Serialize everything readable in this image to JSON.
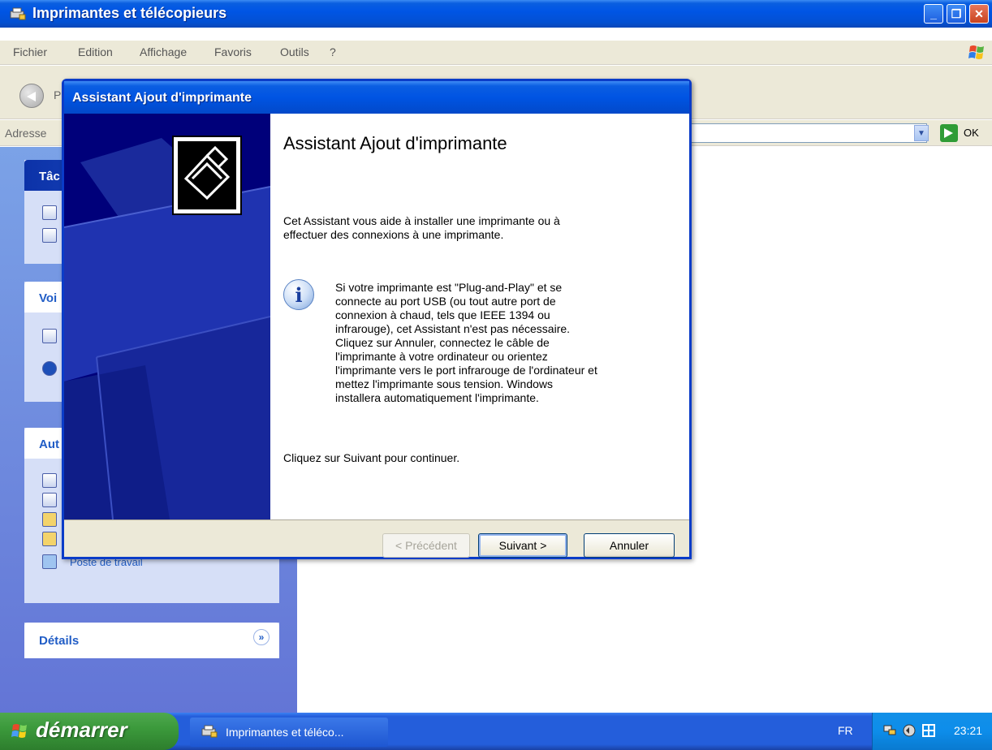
{
  "explorer": {
    "title": "Imprimantes et télécopieurs",
    "menu": [
      "Fichier",
      "Edition",
      "Affichage",
      "Favoris",
      "Outils",
      "?"
    ],
    "back_label": "P",
    "address_label": "Adresse",
    "go_label": "OK",
    "taskpane": {
      "panel1_title": "Tâc",
      "panel2_title": "Voi",
      "panel3_title": "Aut",
      "panel3_item": "Poste de travail",
      "details_title": "Détails"
    }
  },
  "wizard": {
    "title": "Assistant Ajout d'imprimante",
    "heading": "Assistant Ajout d'imprimante",
    "intro_line1": "Cet Assistant vous aide à installer une imprimante ou à",
    "intro_line2": "effectuer des connexions à une imprimante.",
    "info_lines": [
      "Si votre imprimante est \"Plug-and-Play\" et se",
      "connecte au port USB (ou tout autre port de",
      "connexion à chaud, tels que IEEE 1394 ou",
      "infrarouge), cet Assistant n'est pas nécessaire.",
      "Cliquez sur Annuler, connectez le câble de",
      "l'imprimante à votre ordinateur ou orientez",
      "l'imprimante vers le port infrarouge de l'ordinateur et",
      "mettez l'imprimante sous tension. Windows",
      "installera automatiquement l'imprimante."
    ],
    "continue_text": "Cliquez sur Suivant pour continuer.",
    "buttons": {
      "back": "< Précédent",
      "next": "Suivant >",
      "cancel": "Annuler"
    }
  },
  "taskbar": {
    "start_label": "démarrer",
    "task_label": "Imprimantes et téléco...",
    "language": "FR",
    "clock": "23:21"
  },
  "colors": {
    "xp_blue": "#0054e3",
    "taskpane_blue": "#6e8ddf",
    "start_green": "#3c9a3c",
    "wizard_art_navy": "#00007a"
  }
}
